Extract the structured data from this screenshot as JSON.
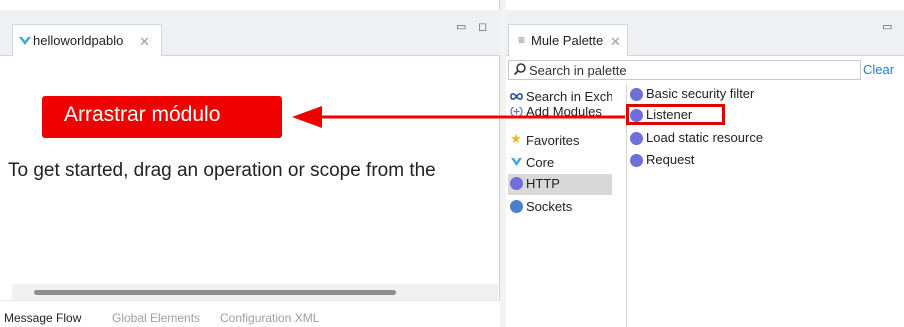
{
  "editor": {
    "tab_label": "helloworldpablo",
    "canvas_hint": "To get started, drag an operation or scope from the",
    "bottom_tabs": [
      {
        "label": "Message Flow",
        "active": true
      },
      {
        "label": "Global Elements",
        "active": false
      },
      {
        "label": "Configuration XML",
        "active": false
      }
    ]
  },
  "annotation": {
    "callout_text": "Arrastrar módulo",
    "color": "#ee0000"
  },
  "palette": {
    "tab_label": "Mule Palette",
    "search_placeholder": "Search in palette",
    "clear_label": "Clear",
    "categories": [
      {
        "label": "Search in Exchange",
        "icon": "exchange-icon",
        "selected": false
      },
      {
        "label": "Add Modules",
        "icon": "plus-circle-icon",
        "selected": false
      },
      {
        "label": "Favorites",
        "icon": "star-icon",
        "selected": false
      },
      {
        "label": "Core",
        "icon": "mule-icon",
        "selected": false
      },
      {
        "label": "HTTP",
        "icon": "http-icon",
        "selected": true
      },
      {
        "label": "Sockets",
        "icon": "sockets-icon",
        "selected": false
      }
    ],
    "operations": [
      {
        "label": "Basic security filter",
        "icon": "http-operation-icon",
        "highlighted": false
      },
      {
        "label": "Listener",
        "icon": "http-operation-icon",
        "highlighted": true
      },
      {
        "label": "Load static resource",
        "icon": "http-operation-icon",
        "highlighted": false
      },
      {
        "label": "Request",
        "icon": "http-operation-icon",
        "highlighted": false
      }
    ],
    "accent_color": "#6e6fd8"
  }
}
